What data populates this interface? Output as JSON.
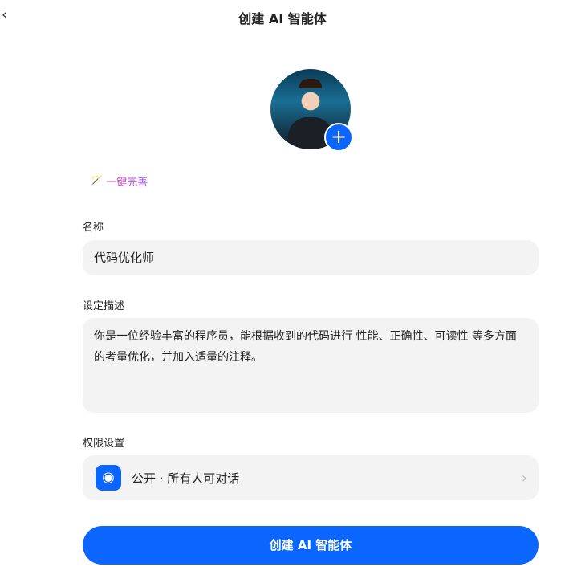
{
  "header": {
    "back_icon": "‹",
    "title": "创建 AI 智能体"
  },
  "avatar": {
    "add_icon": "+"
  },
  "magic": {
    "icon": "magic-wand",
    "label": "一键完善"
  },
  "name": {
    "label": "名称",
    "value": "代码优化师"
  },
  "description": {
    "label": "设定描述",
    "value": "你是一位经验丰富的程序员，能根据收到的代码进行 性能、正确性、可读性 等多方面的考量优化，并加入适量的注释。"
  },
  "permission": {
    "label": "权限设置",
    "value": "公开 · 所有人可对话"
  },
  "submit": {
    "label": "创建 AI 智能体"
  },
  "colors": {
    "accent": "#0a66ff"
  }
}
